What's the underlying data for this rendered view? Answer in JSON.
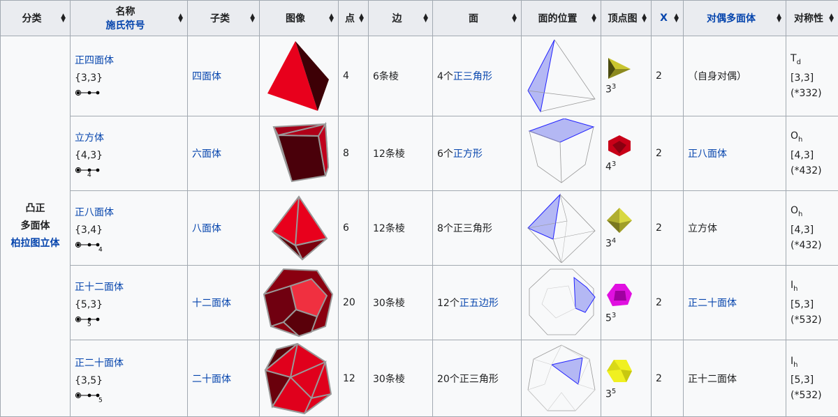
{
  "headers": [
    {
      "label": "分类"
    },
    {
      "label": "名称",
      "sub": "施氏符号"
    },
    {
      "label": "子类"
    },
    {
      "label": "图像"
    },
    {
      "label": "点"
    },
    {
      "label": "边"
    },
    {
      "label": "面"
    },
    {
      "label": "面的位置"
    },
    {
      "label": "顶点图"
    },
    {
      "label": "X",
      "link": true
    },
    {
      "label": "对偶多面体",
      "link": true
    },
    {
      "label": "对称性"
    }
  ],
  "category": {
    "line1": "凸正",
    "line2": "多面体",
    "line3": "柏拉图立体"
  },
  "rows": [
    {
      "name": "正四面体",
      "schlafli": "{3,3}",
      "coxeter_label": "",
      "coxeter_label_edge": 0,
      "subclass": "四面体",
      "image": "tetrahedron-image",
      "vertices": "4",
      "edges": "6条棱",
      "faces_count": "4个",
      "faces_type": "正三角形",
      "faces_link": true,
      "face_pos": "tetrahedron-face-position",
      "vf_image": "vf-triangle-yellow",
      "vf_base": "3",
      "vf_exp": "3",
      "chi": "2",
      "dual": "（自身对偶）",
      "dual_link": false,
      "sym_letter": "T",
      "sym_sub": "d",
      "sym_bracket": "[3,3]",
      "sym_orbifold": "(*332)"
    },
    {
      "name": "立方体",
      "schlafli": "{4,3}",
      "coxeter_label": "4",
      "coxeter_label_edge": 1,
      "subclass": "六面体",
      "image": "cube-image",
      "vertices": "8",
      "edges": "12条棱",
      "faces_count": "6个",
      "faces_type": "正方形",
      "faces_link": true,
      "face_pos": "cube-face-position",
      "vf_image": "vf-red",
      "vf_base": "4",
      "vf_exp": "3",
      "chi": "2",
      "dual": "正八面体",
      "dual_link": true,
      "sym_letter": "O",
      "sym_sub": "h",
      "sym_bracket": "[4,3]",
      "sym_orbifold": "(*432)"
    },
    {
      "name": "正八面体",
      "schlafli": "{3,4}",
      "coxeter_label": "4",
      "coxeter_label_edge": 2,
      "subclass": "八面体",
      "image": "octahedron-image",
      "vertices": "6",
      "edges": "12条棱",
      "faces_count": "8个",
      "faces_type": "正三角形",
      "faces_link": false,
      "face_pos": "octahedron-face-position",
      "vf_image": "vf-octa-yellow",
      "vf_base": "3",
      "vf_exp": "4",
      "chi": "2",
      "dual": "立方体",
      "dual_link": false,
      "sym_letter": "O",
      "sym_sub": "h",
      "sym_bracket": "[4,3]",
      "sym_orbifold": "(*432)"
    },
    {
      "name": "正十二面体",
      "schlafli": "{5,3}",
      "coxeter_label": "5",
      "coxeter_label_edge": 1,
      "subclass": "十二面体",
      "image": "dodecahedron-image",
      "vertices": "20",
      "edges": "30条棱",
      "faces_count": "12个",
      "faces_type": "正五边形",
      "faces_link": true,
      "face_pos": "dodecahedron-face-position",
      "vf_image": "vf-magenta",
      "vf_base": "5",
      "vf_exp": "3",
      "chi": "2",
      "dual": "正二十面体",
      "dual_link": true,
      "sym_letter": "I",
      "sym_sub": "h",
      "sym_bracket": "[5,3]",
      "sym_orbifold": "(*532)"
    },
    {
      "name": "正二十面体",
      "schlafli": "{3,5}",
      "coxeter_label": "5",
      "coxeter_label_edge": 2,
      "subclass": "二十面体",
      "image": "icosahedron-image",
      "vertices": "12",
      "edges": "30条棱",
      "faces_count": "20个",
      "faces_type": "正三角形",
      "faces_link": false,
      "face_pos": "icosahedron-face-position",
      "vf_image": "vf-yellow",
      "vf_base": "3",
      "vf_exp": "5",
      "chi": "2",
      "dual": "正十二面体",
      "dual_link": false,
      "sym_letter": "I",
      "sym_sub": "h",
      "sym_bracket": "[5,3]",
      "sym_orbifold": "(*532)"
    }
  ],
  "colors": {
    "link": "#0645ad",
    "header_bg": "#eaecf0",
    "cell_bg": "#f8f9fa",
    "border": "#a2a9b1",
    "solid_red": "#e8001c",
    "face_blue": "#b4b8f4"
  }
}
